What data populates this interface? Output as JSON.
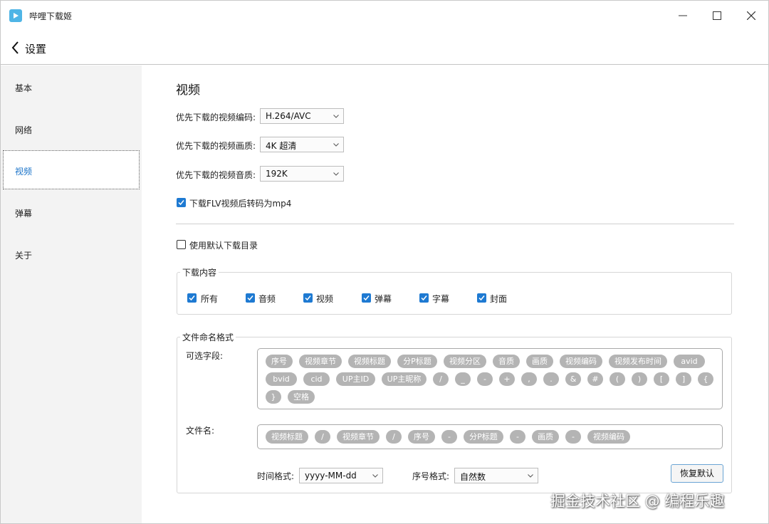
{
  "window": {
    "title": "哔哩下载姬",
    "icon": "play-icon",
    "accent_color": "#4fb5e6"
  },
  "header": {
    "back_label": "设置"
  },
  "sidebar": {
    "items": [
      {
        "label": "基本"
      },
      {
        "label": "网络"
      },
      {
        "label": "视频",
        "active": true
      },
      {
        "label": "弹幕"
      },
      {
        "label": "关于"
      }
    ]
  },
  "video": {
    "title": "视频",
    "codec": {
      "label": "优先下载的视频编码:",
      "value": "H.264/AVC"
    },
    "quality": {
      "label": "优先下载的视频画质:",
      "value": "4K 超清"
    },
    "audio": {
      "label": "优先下载的视频音质:",
      "value": "192K"
    },
    "flv_to_mp4": {
      "label": "下载FLV视频后转码为mp4",
      "checked": true
    },
    "default_dir": {
      "label": "使用默认下载目录",
      "checked": false
    }
  },
  "download_content": {
    "legend": "下载内容",
    "items": [
      {
        "label": "所有",
        "checked": true
      },
      {
        "label": "音频",
        "checked": true
      },
      {
        "label": "视频",
        "checked": true
      },
      {
        "label": "弹幕",
        "checked": true
      },
      {
        "label": "字幕",
        "checked": true
      },
      {
        "label": "封面",
        "checked": true
      }
    ]
  },
  "file_naming": {
    "legend": "文件命名格式",
    "optional_label": "可选字段:",
    "optional_fields": [
      "序号",
      "视频章节",
      "视频标题",
      "分P标题",
      "视频分区",
      "音质",
      "画质",
      "视频编码",
      "视频发布时间",
      "avid",
      "bvid",
      "cid",
      "UP主ID",
      "UP主昵称",
      "/",
      "_",
      "-",
      "+",
      ",",
      ".",
      "&",
      "#",
      "(",
      ")",
      "[",
      "]",
      "{",
      "}",
      "空格"
    ],
    "filename_label": "文件名:",
    "filename_fields": [
      "视频标题",
      "/",
      "视频章节",
      "/",
      "序号",
      "-",
      "分P标题",
      "-",
      "画质",
      "-",
      "视频编码"
    ],
    "time_format": {
      "label": "时间格式:",
      "value": "yyyy-MM-dd"
    },
    "number_format": {
      "label": "序号格式:",
      "value": "自然数"
    },
    "reset_label": "恢复默认"
  },
  "watermark": "掘金技术社区 @ 编程乐趣"
}
